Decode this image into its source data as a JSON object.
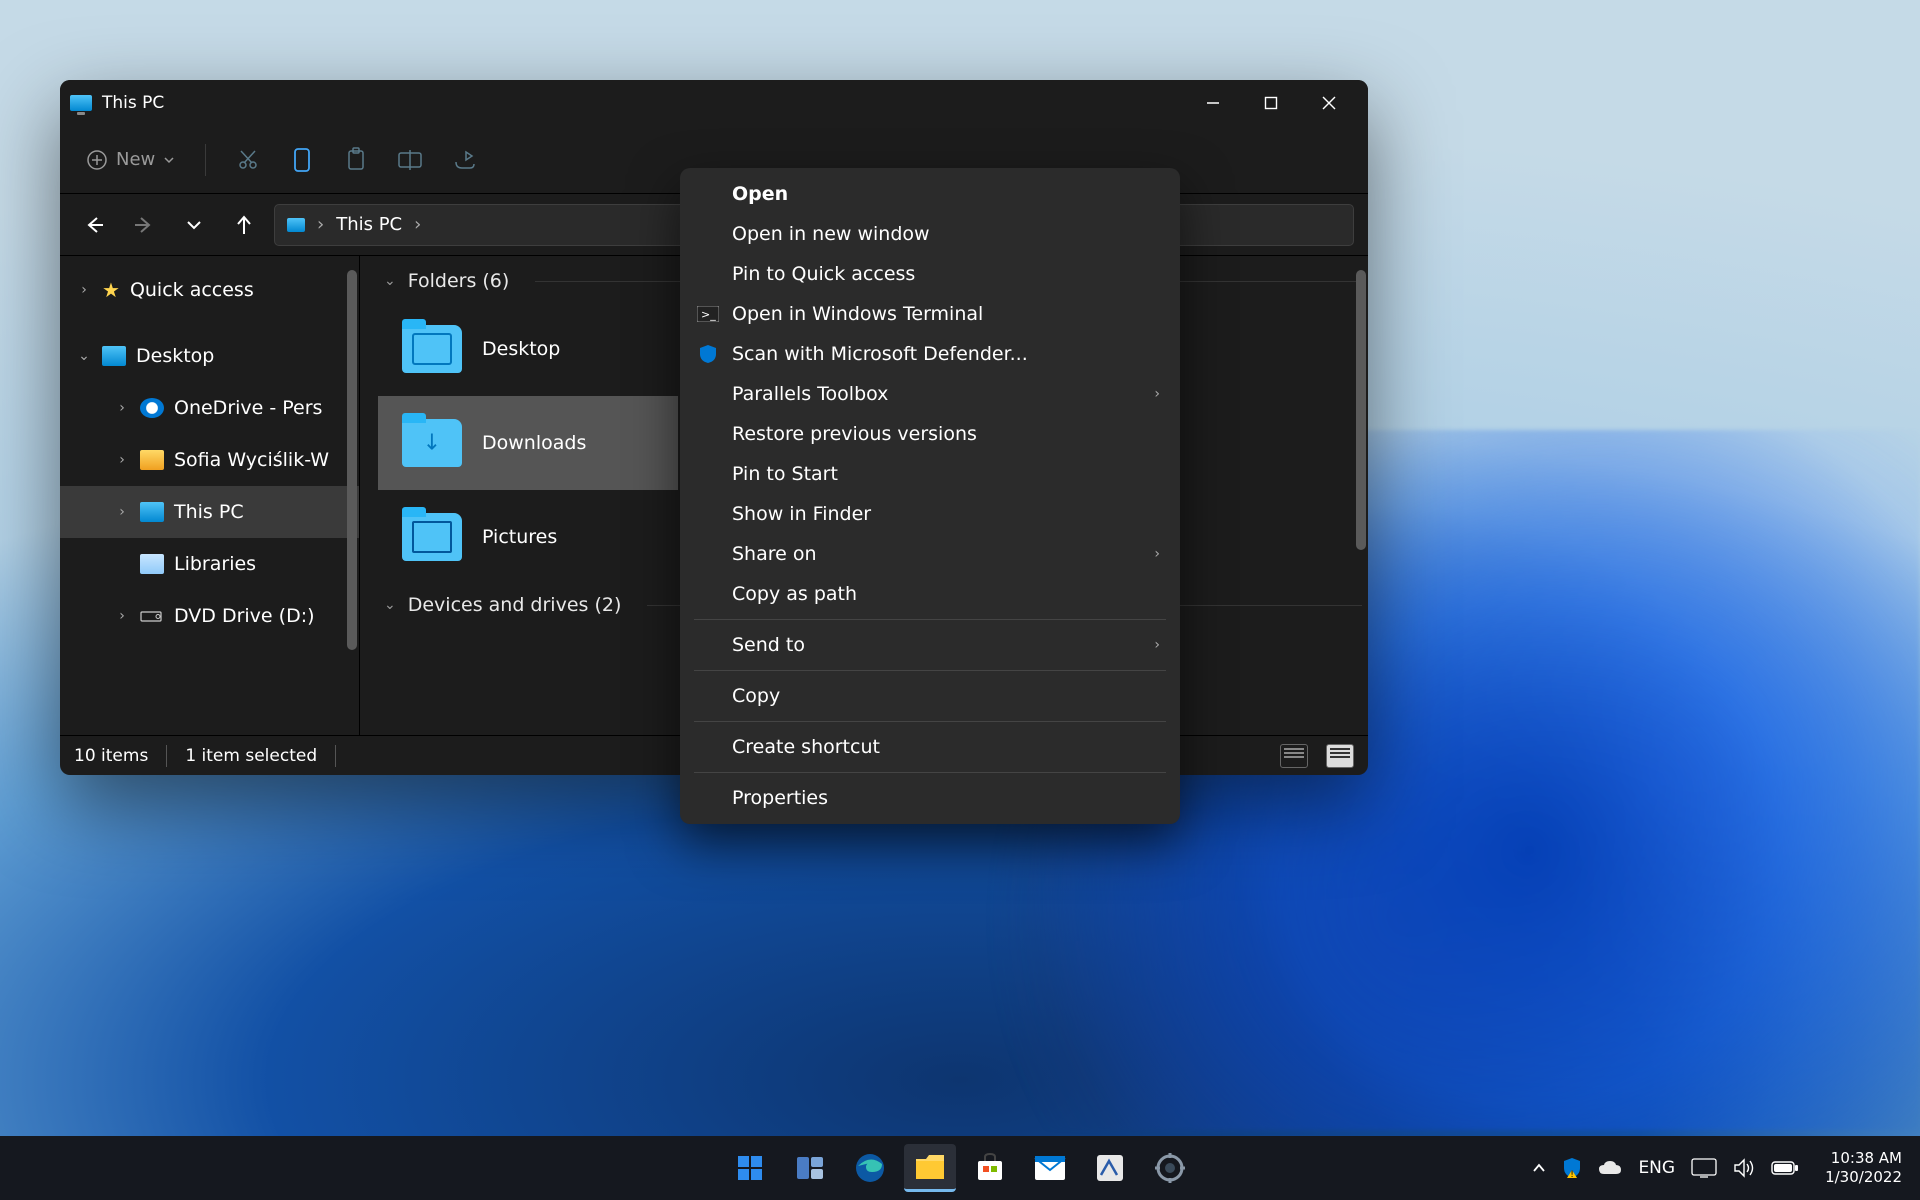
{
  "window": {
    "title": "This PC",
    "toolbar": {
      "new_label": "New"
    },
    "address": {
      "location": "This PC"
    },
    "sidebar": {
      "items": [
        {
          "label": "Quick access",
          "icon": "star",
          "caret": "right",
          "indent": 0
        },
        {
          "label": "Desktop",
          "icon": "monitor",
          "caret": "down",
          "indent": 0
        },
        {
          "label": "OneDrive - Pers",
          "icon": "cloud",
          "caret": "right",
          "indent": 1
        },
        {
          "label": "Sofia Wyciślik-W",
          "icon": "folder",
          "caret": "right",
          "indent": 1
        },
        {
          "label": "This PC",
          "icon": "monitor",
          "caret": "right",
          "indent": 1,
          "selected": true
        },
        {
          "label": "Libraries",
          "icon": "libs",
          "caret": "",
          "indent": 1
        },
        {
          "label": "DVD Drive (D:)",
          "icon": "dvd",
          "caret": "right",
          "indent": 1
        }
      ]
    },
    "main": {
      "groups": [
        {
          "label": "Folders (6)",
          "items": [
            {
              "label": "Desktop",
              "glyph": "desktop"
            },
            {
              "label": "Downloads",
              "glyph": "downloads",
              "selected": true
            },
            {
              "label": "Pictures",
              "glyph": "pictures"
            }
          ]
        },
        {
          "label": "Devices and drives (2)",
          "items": []
        }
      ]
    },
    "statusbar": {
      "count": "10 items",
      "selected": "1 item selected"
    }
  },
  "context_menu": {
    "items": [
      {
        "label": "Open",
        "bold": true
      },
      {
        "label": "Open in new window"
      },
      {
        "label": "Pin to Quick access"
      },
      {
        "label": "Open in Windows Terminal",
        "icon": "terminal"
      },
      {
        "label": "Scan with Microsoft Defender...",
        "icon": "shield"
      },
      {
        "label": "Parallels Toolbox",
        "submenu": true
      },
      {
        "label": "Restore previous versions"
      },
      {
        "label": "Pin to Start"
      },
      {
        "label": "Show in Finder"
      },
      {
        "label": "Share on",
        "submenu": true
      },
      {
        "label": "Copy as path"
      },
      {
        "divider": true
      },
      {
        "label": "Send to",
        "submenu": true
      },
      {
        "divider": true
      },
      {
        "label": "Copy"
      },
      {
        "divider": true
      },
      {
        "label": "Create shortcut"
      },
      {
        "divider": true
      },
      {
        "label": "Properties"
      }
    ]
  },
  "taskbar": {
    "tray": {
      "lang": "ENG"
    },
    "clock": {
      "time": "10:38 AM",
      "date": "1/30/2022"
    }
  }
}
